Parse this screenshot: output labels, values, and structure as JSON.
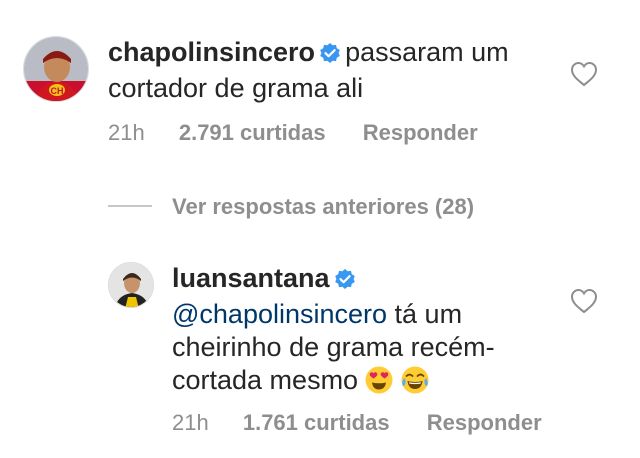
{
  "comment1": {
    "username": "chapolinsincero",
    "text_line1": "passaram um",
    "text_line2": "cortador de grama ali",
    "time": "21h",
    "likes": "2.791 curtidas",
    "reply": "Responder"
  },
  "view_replies": "Ver respostas anteriores (28)",
  "comment2": {
    "username": "luansantana",
    "mention": "@chapolinsincero",
    "text_line1_rest": " tá um",
    "text_line2": "cheirinho de grama recém-",
    "text_line3": "cortada mesmo",
    "time": "21h",
    "likes": "1.761 curtidas",
    "reply": "Responder"
  },
  "icons": {
    "verified": "verified-badge-icon",
    "heart": "heart-outline-icon",
    "emoji1": "heart-eyes-emoji",
    "emoji2": "tears-of-joy-emoji"
  },
  "colors": {
    "text": "#262626",
    "secondary": "#8e8e8e",
    "mention": "#00376b",
    "verified": "#3897f0"
  }
}
